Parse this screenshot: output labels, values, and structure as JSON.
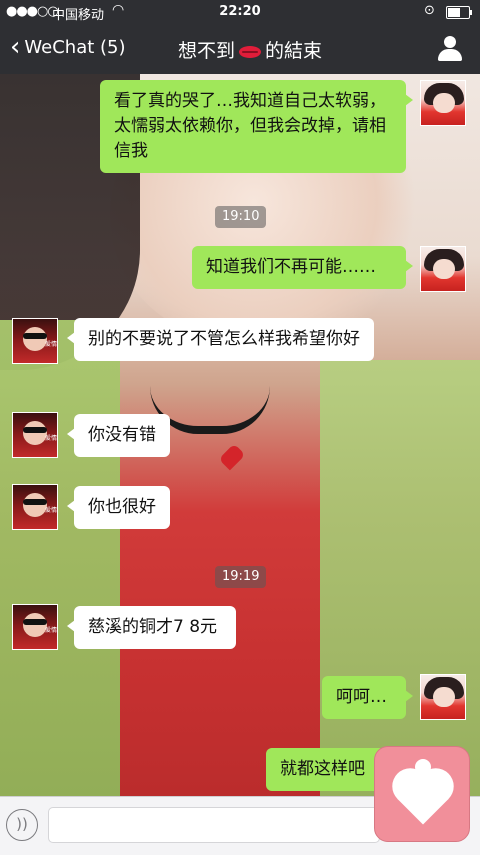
{
  "status_bar": {
    "signal": "●●●○○",
    "carrier": "中国移动",
    "time": "22:20"
  },
  "nav": {
    "back_label": "WeChat (5)",
    "title_left": "想不到",
    "title_right": "的結束"
  },
  "messages": [
    {
      "from": "me",
      "text": "看了真的哭了…我知道自己太软弱，太懦弱太依赖你，但我会改掉，请相信我"
    },
    {
      "from": "me",
      "text": "知道我们不再可能……"
    },
    {
      "from": "other",
      "text": "别的不要说了不管怎么样我希望你好"
    },
    {
      "from": "other",
      "text": "你没有错"
    },
    {
      "from": "other",
      "text": "你也很好"
    },
    {
      "from": "other",
      "text": "慈溪的铜才7 8元"
    },
    {
      "from": "me",
      "text": "呵呵…"
    },
    {
      "from": "me",
      "text": "就都这样吧"
    }
  ],
  "timestamps": [
    "19:10",
    "19:19"
  ],
  "icons": {
    "back": "chevron-left-icon",
    "contact": "person-icon",
    "voice": "voice-icon",
    "sticker": "heart-sticker-icon"
  },
  "colors": {
    "bar": "#2e2f33",
    "outgoing": "#a0e75a",
    "incoming": "#ffffff"
  }
}
